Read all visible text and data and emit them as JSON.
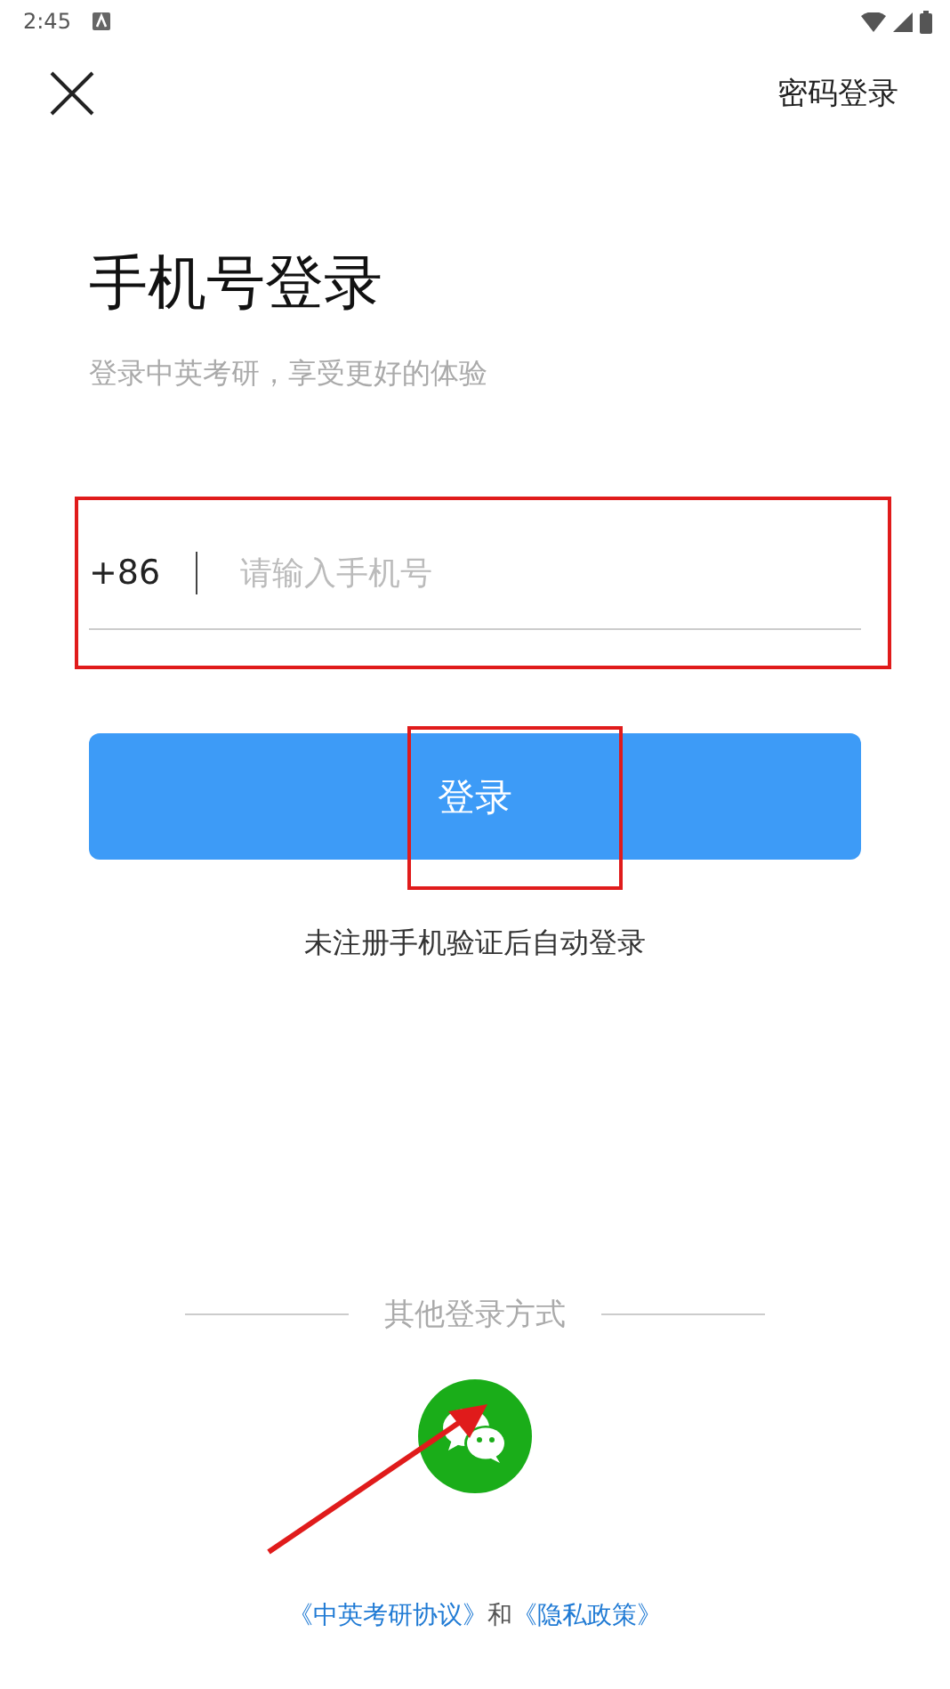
{
  "status_bar": {
    "time": "2:45"
  },
  "top_bar": {
    "password_login": "密码登录"
  },
  "title": "手机号登录",
  "subtitle": "登录中英考研，享受更好的体验",
  "phone_field": {
    "country_code": "+86",
    "placeholder": "请输入手机号"
  },
  "login_button": "登录",
  "note": "未注册手机验证后自动登录",
  "other_login": {
    "label": "其他登录方式"
  },
  "footer": {
    "agreement": "《中英考研协议》",
    "and": "和",
    "privacy": "《隐私政策》"
  }
}
